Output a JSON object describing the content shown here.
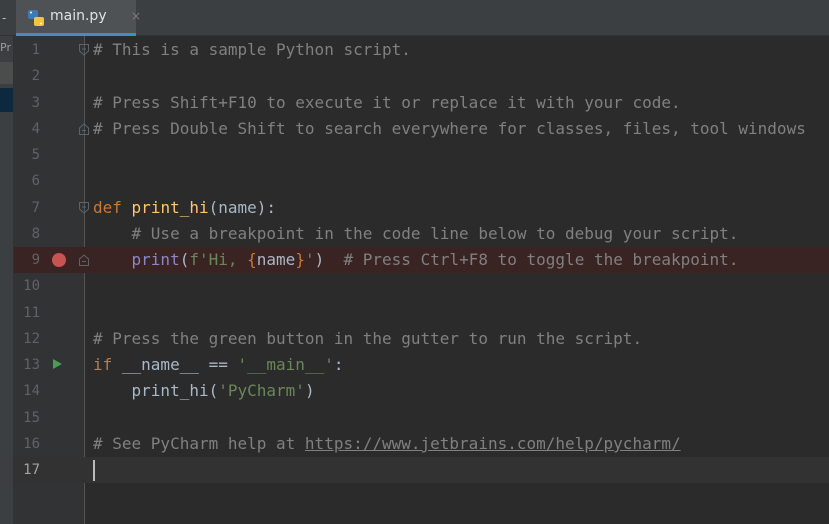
{
  "tabbar": {
    "left_glyph": "-"
  },
  "tab": {
    "label": "main.py",
    "close": "×",
    "icon": "python-file-icon"
  },
  "project_strip": {
    "label": "Pr"
  },
  "gutter": {
    "line_numbers": [
      "1",
      "2",
      "3",
      "4",
      "5",
      "6",
      "7",
      "8",
      "9",
      "10",
      "11",
      "12",
      "13",
      "14",
      "15",
      "16",
      "17"
    ],
    "current_line": "17",
    "breakpoint_line": "9",
    "run_marker_line": "13"
  },
  "code": {
    "l1": {
      "comment": "# This is a sample Python script."
    },
    "l3": {
      "comment": "# Press Shift+F10 to execute it or replace it with your code."
    },
    "l4": {
      "comment": "# Press Double Shift to search everywhere for classes, files, tool windows"
    },
    "l7": {
      "kw": "def",
      "fn": "print_hi",
      "rest": "(name):"
    },
    "l8": {
      "indent": "    ",
      "comment": "# Use a breakpoint in the code line below to debug your script."
    },
    "l9": {
      "indent": "    ",
      "builtin": "print",
      "p_open": "(",
      "fprefix": "f'Hi, ",
      "brace_open": "{",
      "fvar": "name",
      "brace_close": "}",
      "fsuffix": "'",
      "p_close": ")",
      "gap": "  ",
      "comment": "# Press Ctrl+F8 to toggle the breakpoint."
    },
    "l12": {
      "comment": "# Press the green button in the gutter to run the script."
    },
    "l13": {
      "kw": "if",
      "mid": " __name__ == ",
      "str": "'__main__'",
      "end": ":"
    },
    "l14": {
      "indent": "    ",
      "call": "print_hi(",
      "str": "'PyCharm'",
      "end": ")"
    },
    "l16": {
      "comment": "# See PyCharm help at ",
      "link": "https://www.jetbrains.com/help/pycharm/"
    }
  },
  "colors": {
    "background": "#2b2b2b",
    "gutter": "#313335",
    "comment": "#808080",
    "keyword": "#cc7832",
    "function": "#ffc66d",
    "builtin": "#8888c6",
    "string": "#6a8759",
    "breakpoint": "#c75450",
    "run": "#499c54"
  }
}
